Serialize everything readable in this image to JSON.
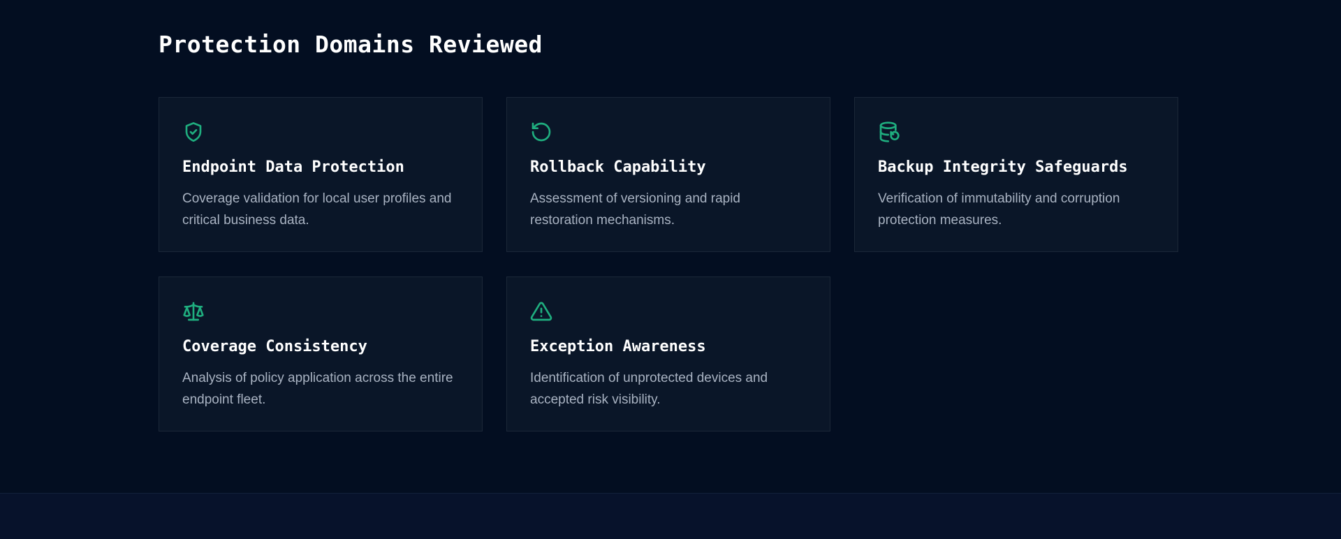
{
  "section": {
    "title": "Protection Domains Reviewed"
  },
  "accent_color": "#1fae7f",
  "cards": [
    {
      "icon": "shield-check-icon",
      "title": "Endpoint Data Protection",
      "description": "Coverage validation for local user profiles and critical business data."
    },
    {
      "icon": "rotate-ccw-icon",
      "title": "Rollback Capability",
      "description": "Assessment of versioning and rapid restoration mechanisms."
    },
    {
      "icon": "database-restore-icon",
      "title": "Backup Integrity Safeguards",
      "description": "Verification of immutability and corruption protection measures."
    },
    {
      "icon": "scale-icon",
      "title": "Coverage Consistency",
      "description": "Analysis of policy application across the entire endpoint fleet."
    },
    {
      "icon": "alert-triangle-icon",
      "title": "Exception Awareness",
      "description": "Identification of unprotected devices and accepted risk visibility."
    }
  ]
}
